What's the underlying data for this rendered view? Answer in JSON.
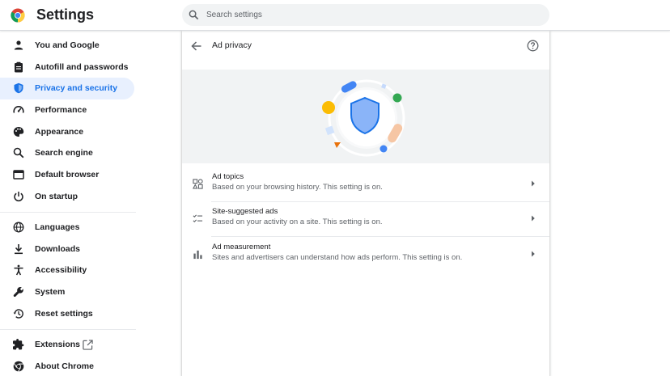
{
  "header": {
    "title": "Settings",
    "search_placeholder": "Search settings"
  },
  "sidebar": {
    "items": [
      {
        "label": "You and Google",
        "icon": "person-icon"
      },
      {
        "label": "Autofill and passwords",
        "icon": "clipboard-icon"
      },
      {
        "label": "Privacy and security",
        "icon": "shield-icon",
        "active": true
      },
      {
        "label": "Performance",
        "icon": "speedometer-icon"
      },
      {
        "label": "Appearance",
        "icon": "palette-icon"
      },
      {
        "label": "Search engine",
        "icon": "search-icon"
      },
      {
        "label": "Default browser",
        "icon": "browser-icon"
      },
      {
        "label": "On startup",
        "icon": "power-icon"
      },
      {
        "label": "Languages",
        "icon": "globe-icon"
      },
      {
        "label": "Downloads",
        "icon": "download-icon"
      },
      {
        "label": "Accessibility",
        "icon": "accessibility-icon"
      },
      {
        "label": "System",
        "icon": "wrench-icon"
      },
      {
        "label": "Reset settings",
        "icon": "history-icon"
      },
      {
        "label": "Extensions",
        "icon": "puzzle-icon"
      },
      {
        "label": "About Chrome",
        "icon": "chrome-icon"
      }
    ]
  },
  "main": {
    "title": "Ad privacy",
    "rows": [
      {
        "title": "Ad topics",
        "subtitle": "Based on your browsing history. This setting is on.",
        "icon": "topics-icon"
      },
      {
        "title": "Site-suggested ads",
        "subtitle": "Based on your activity on a site. This setting is on.",
        "icon": "checklist-icon"
      },
      {
        "title": "Ad measurement",
        "subtitle": "Sites and advertisers can understand how ads perform. This setting is on.",
        "icon": "bar-chart-icon"
      }
    ]
  },
  "colors": {
    "accent": "#1a73e8",
    "active_bg": "#e8f0fe",
    "banner_bg": "#f1f3f4"
  }
}
